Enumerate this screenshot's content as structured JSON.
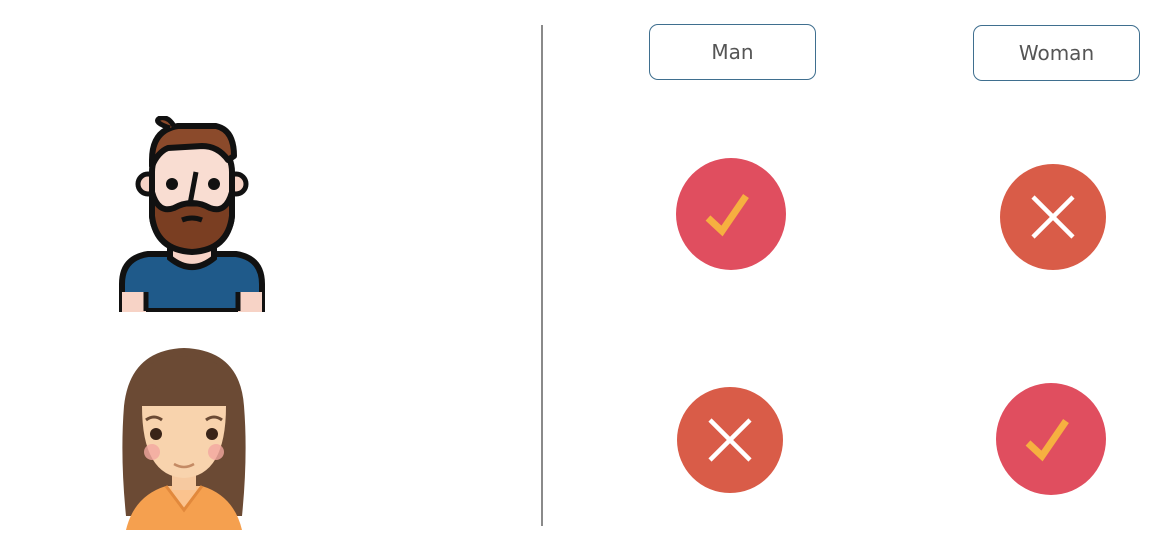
{
  "columns": [
    {
      "label": "Man"
    },
    {
      "label": "Woman"
    }
  ],
  "rows": [
    {
      "avatar": "man-with-beard-icon",
      "results": [
        "check",
        "cross"
      ]
    },
    {
      "avatar": "woman-with-long-hair-icon",
      "results": [
        "cross",
        "check"
      ]
    }
  ],
  "colors": {
    "check_bg": "#e04e5f",
    "check_mark": "#f6b040",
    "cross_bg": "#d95c48",
    "cross_mark": "#ffffff",
    "button_border": "#3f6f8f",
    "divider": "#8a8a8a"
  }
}
